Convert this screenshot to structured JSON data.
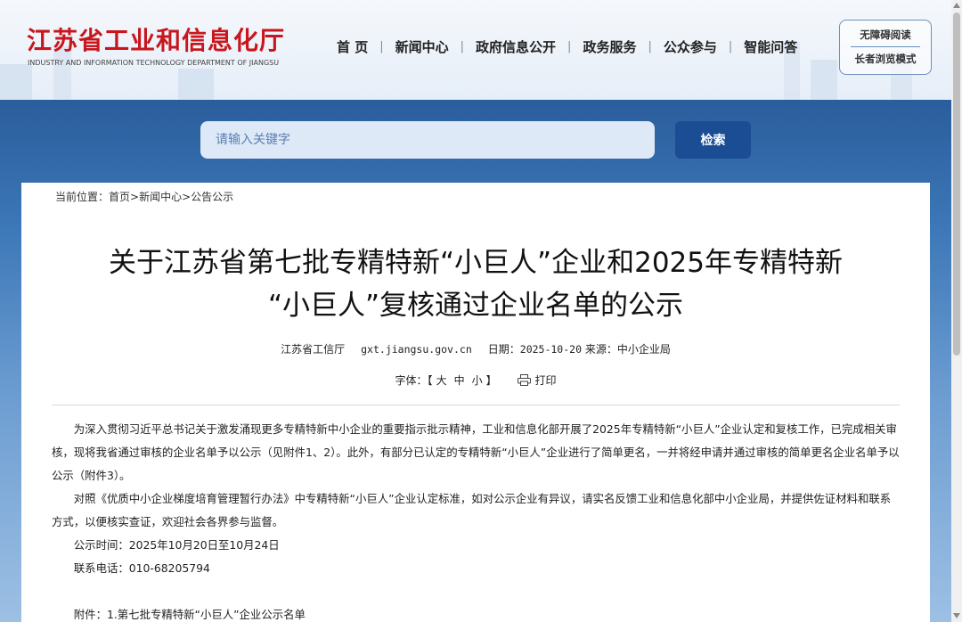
{
  "header": {
    "logo_cn": "江苏省工业和信息化厅",
    "logo_en": "INDUSTRY AND INFORMATION TECHNOLOGY DEPARTMENT OF JIANGSU",
    "nav": [
      "首 页",
      "新闻中心",
      "政府信息公开",
      "政务服务",
      "公众参与",
      "智能问答"
    ],
    "nav_separator": "|",
    "accessibility": "无障碍阅读",
    "elder_mode": "长者浏览模式"
  },
  "search": {
    "placeholder": "请输入关键字",
    "value": "",
    "button": "检索"
  },
  "breadcrumb": {
    "prefix": "当前位置：",
    "items": [
      "首页",
      "新闻中心",
      "公告公示"
    ],
    "separator": ">"
  },
  "article": {
    "title_line1": "关于江苏省第七批专精特新“小巨人”企业和2025年专精特新",
    "title_line2": "“小巨人”复核通过企业名单的公示",
    "source": "江苏省工信厅",
    "site": "gxt.jiangsu.gov.cn",
    "date_label": "日期：",
    "date": "2025-10-20",
    "origin_label": "来源：",
    "origin": "中小企业局",
    "font_label": "字体：",
    "font_open": "【",
    "font_options": [
      "大",
      "中",
      "小"
    ],
    "font_close": "】",
    "print_label": "打印",
    "paragraphs": [
      "为深入贯彻习近平总书记关于激发涌现更多专精特新中小企业的重要指示批示精神，工业和信息化部开展了2025年专精特新“小巨人”企业认定和复核工作，已完成相关审核，现将我省通过审核的企业名单予以公示（见附件1、2）。此外，有部分已认定的专精特新“小巨人”企业进行了简单更名，一并将经申请并通过审核的简单更名企业名单予以公示（附件3）。",
      "对照《优质中小企业梯度培育管理暂行办法》中专精特新“小巨人”企业认定标准，如对公示企业有异议，请实名反馈工业和信息化部中小企业局，并提供佐证材料和联系方式，以便核实查证，欢迎社会各界参与监督。",
      "公示时间：2025年10月20日至10月24日",
      "联系电话：010-68205794"
    ],
    "attachment": "附件：1.第七批专精特新“小巨人”企业公示名单"
  },
  "colors": {
    "brand_red": "#c8161d",
    "search_button": "#1a4d93",
    "band_top": "#2a5d9c"
  },
  "icons": {
    "print": "printer-icon"
  }
}
